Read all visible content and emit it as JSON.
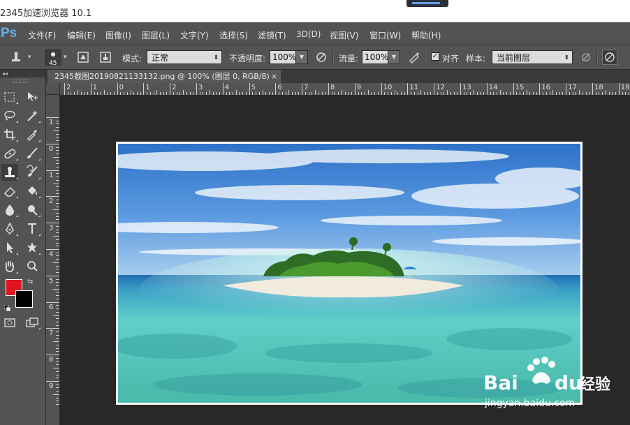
{
  "window": {
    "title": "2345加速浏览器 10.1"
  },
  "app": {
    "logo": "Ps"
  },
  "menu": {
    "items": [
      "文件(F)",
      "编辑(E)",
      "图像(I)",
      "图层(L)",
      "文字(Y)",
      "选择(S)",
      "滤镜(T)",
      "3D(D)",
      "视图(V)",
      "窗口(W)",
      "帮助(H)"
    ]
  },
  "options": {
    "brush_size": "45",
    "mode_label": "模式:",
    "mode_value": "正常",
    "opacity_label": "不透明度:",
    "opacity_value": "100%",
    "flow_label": "流量:",
    "flow_value": "100%",
    "aligned_label": "对齐",
    "aligned_checked": true,
    "sample_label": "样本:",
    "sample_value": "当前图层"
  },
  "document": {
    "tab_title": "2345截图20190821133132.png @ 100% (图层 0, RGB/8)",
    "close_glyph": "×"
  },
  "rulers": {
    "horizontal_numbers": [
      "2",
      "1",
      "0",
      "1",
      "2",
      "3",
      "4",
      "5",
      "6",
      "7",
      "8",
      "9",
      "10",
      "11",
      "12",
      "13",
      "14",
      "15",
      "16",
      "17",
      "18",
      "19"
    ],
    "vertical_numbers": [
      "1",
      "0",
      "1",
      "2",
      "3",
      "4",
      "5",
      "6",
      "7",
      "8",
      "9"
    ]
  },
  "colors": {
    "foreground": "#e0141e",
    "background": "#000000",
    "accent_ps": "#5fb3f0"
  },
  "watermark": {
    "brand": "Bai",
    "brand_cn": "经验",
    "url": "jingyan.baidu.com"
  }
}
